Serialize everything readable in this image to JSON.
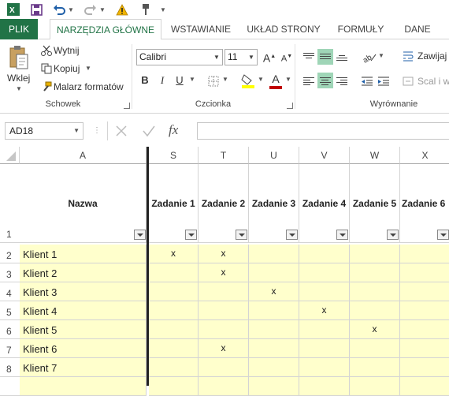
{
  "qat": {
    "excel_icon": "excel-logo-icon",
    "save_icon": "save-icon",
    "undo_icon": "undo-icon",
    "redo_icon": "redo-icon",
    "warning_icon": "warning-icon",
    "pin_icon": "pin-icon"
  },
  "tabs": [
    "PLIK",
    "NARZĘDZIA GŁÓWNE",
    "WSTAWIANIE",
    "UKŁAD STRONY",
    "FORMUŁY",
    "DANE"
  ],
  "ribbon": {
    "clipboard": {
      "paste_label": "Wklej",
      "cut_label": "Wytnij",
      "copy_label": "Kopiuj",
      "format_painter_label": "Malarz formatów",
      "group_label": "Schowek"
    },
    "font": {
      "font_name": "Calibri",
      "font_size": "11",
      "bold": "B",
      "italic": "I",
      "underline": "U",
      "grow": "A",
      "shrink": "A",
      "color_letter": "A",
      "group_label": "Czcionka",
      "fill_color": "#ffff00",
      "font_color": "#c00000"
    },
    "alignment": {
      "wrap_label": "Zawijaj",
      "merge_label": "Scal i w",
      "group_label": "Wyrównanie"
    }
  },
  "formula_bar": {
    "name_box": "AD18",
    "fx": "fx",
    "formula": ""
  },
  "columns": [
    "A",
    "S",
    "T",
    "U",
    "V",
    "W",
    "X"
  ],
  "header_row": {
    "row_num": "1",
    "titles": [
      "Nazwa",
      "Zadanie 1",
      "Zadanie 2",
      "Zadanie 3",
      "Zadanie 4",
      "Zadanie 5",
      "Zadanie 6"
    ]
  },
  "rows": [
    {
      "num": "2",
      "name": "Klient 1",
      "marks": [
        "x",
        "x",
        "",
        "",
        "",
        ""
      ]
    },
    {
      "num": "3",
      "name": "Klient 2",
      "marks": [
        "",
        "x",
        "",
        "",
        "",
        ""
      ]
    },
    {
      "num": "4",
      "name": "Klient 3",
      "marks": [
        "",
        "",
        "x",
        "",
        "",
        ""
      ]
    },
    {
      "num": "5",
      "name": "Klient 4",
      "marks": [
        "",
        "",
        "",
        "x",
        "",
        ""
      ]
    },
    {
      "num": "6",
      "name": "Klient 5",
      "marks": [
        "",
        "",
        "",
        "",
        "x",
        ""
      ]
    },
    {
      "num": "7",
      "name": "Klient 6",
      "marks": [
        "",
        "x",
        "",
        "",
        "",
        ""
      ]
    },
    {
      "num": "8",
      "name": "Klient 7",
      "marks": [
        "",
        "",
        "",
        "",
        "",
        ""
      ]
    },
    {
      "num": "",
      "name": "",
      "marks": [
        "",
        "",
        "",
        "",
        "",
        ""
      ]
    }
  ],
  "colors": {
    "accent": "#217346",
    "table_fill": "#ffffcc",
    "selected_align": "#9fd5b7"
  }
}
